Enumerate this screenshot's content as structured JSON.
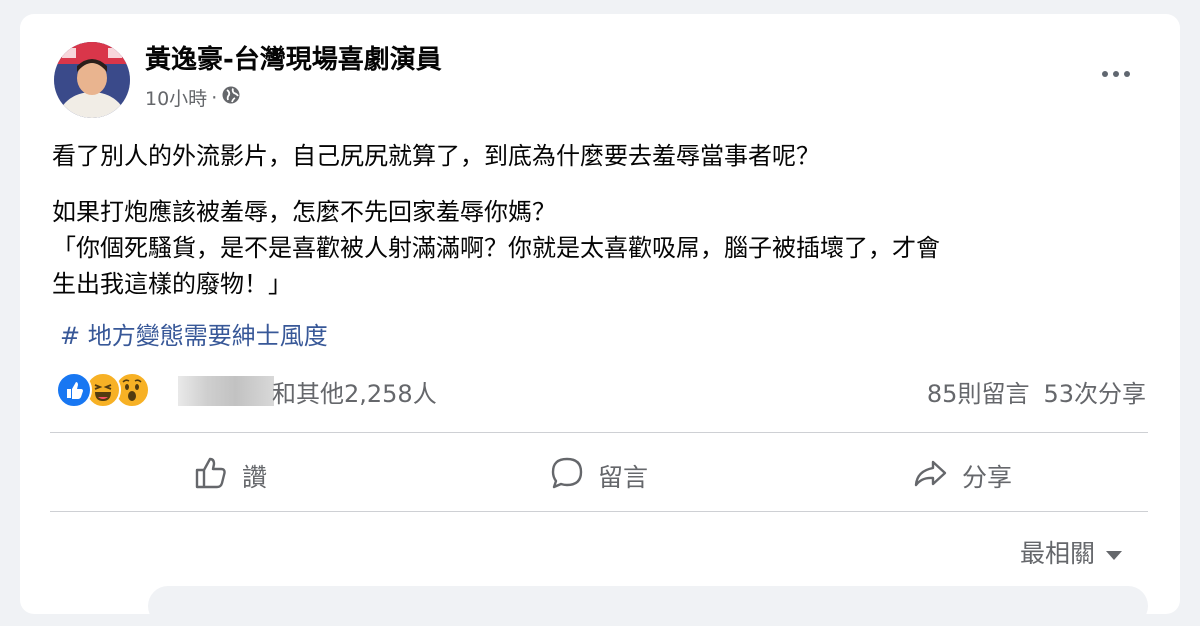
{
  "post": {
    "author": "黃逸豪-台灣現場喜劇演員",
    "time": "10小時",
    "separator": "·",
    "audience_icon": "globe-icon",
    "more_icon": "more-horizontal-icon",
    "paragraphs": [
      "看了別人的外流影片，自己尻尻就算了，到底為什麼要去羞辱當事者呢？",
      "如果打炮應該被羞辱，怎麼不先回家羞辱你媽？",
      "「你個死騷貨，是不是喜歡被人射滿滿啊？你就是太喜歡吸屌，腦子被插壞了，才會",
      "生出我這樣的廢物！」"
    ],
    "hashtag": "# 地方變態需要紳士風度"
  },
  "stats": {
    "reaction_icons": [
      "like-reaction-icon",
      "haha-reaction-icon",
      "wow-reaction-icon"
    ],
    "others": "和其他2,258人",
    "comments": "85則留言",
    "shares": "53次分享"
  },
  "actions": {
    "like": "讚",
    "comment": "留言",
    "share": "分享"
  },
  "comments_sort": {
    "label": "最相關"
  },
  "colors": {
    "like_blue": "#1877f2",
    "hashtag_blue": "#385898",
    "secondary_text": "#65676b",
    "reaction_yellow": "#f7b125"
  }
}
